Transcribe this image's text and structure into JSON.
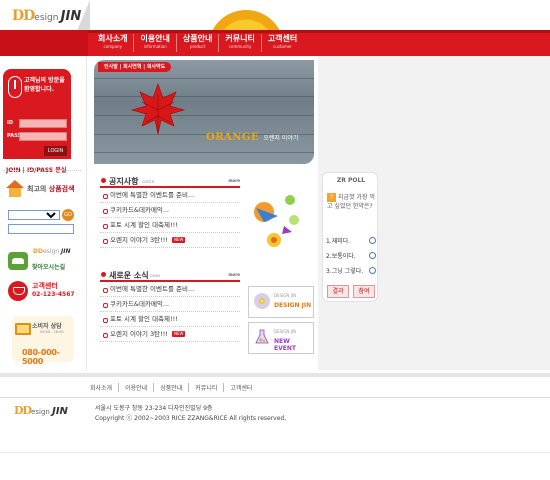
{
  "brand": {
    "dd": "DD",
    "design": "esign",
    "jin": "JIN"
  },
  "nav": [
    {
      "ko": "회사소개",
      "en": "company"
    },
    {
      "ko": "이용안내",
      "en": "information"
    },
    {
      "ko": "상품안내",
      "en": "product"
    },
    {
      "ko": "커뮤니티",
      "en": "community"
    },
    {
      "ko": "고객센터",
      "en": "customer"
    }
  ],
  "login": {
    "greeting": "고객님의 방문을 환영합니다.",
    "id_label": "ID",
    "pass_label": "PASS",
    "button": "LOGIN",
    "join": "JOIN",
    "find": "ID/PASS 분실"
  },
  "best_search": {
    "prefix": "최고의 ",
    "highlight": "상품검색",
    "go": "GO"
  },
  "map": {
    "label": "찾아오시는길"
  },
  "customer_center": {
    "title": "고객센터",
    "phone": "02-123-4567"
  },
  "consult": {
    "title": "소비자 상담",
    "hours": "09:00 - 18:00",
    "phone": "080-000-5000"
  },
  "banner": {
    "breadcrumb": "인사말 | 회사연혁 | 회사약도",
    "brand": "ORANGE",
    "subtitle": "오렌지 이야기"
  },
  "notice": {
    "title": "공지사항",
    "subtitle": "notice",
    "more": "more",
    "items": [
      "이번에 특별한 이벤트를 준비...",
      "쿠키카드&데카메익...",
      "포토 시계 할인 대축제!!!",
      "오렌지 이야기 3탄!!!"
    ],
    "new_badge": "NEW"
  },
  "news": {
    "title": "새로운 소식",
    "subtitle": "news",
    "more": "more",
    "items": [
      "이번에 특별한 이벤트를 준비...",
      "쿠키카드&데카메익...",
      "포토 시계 할인 대축제!!!",
      "오렌지 이야기 3탄!!!"
    ],
    "new_badge": "NEW"
  },
  "side_banners": [
    {
      "small": "DESIGN JIN",
      "big": "DESIGN JIN"
    },
    {
      "small": "DESIGN JIN",
      "big": "NEW EVENT"
    }
  ],
  "poll": {
    "title": "ZR POLL",
    "question": "지금껏 가장 먹고 싶었던 한약은?",
    "options": [
      "1.재미다.",
      "2.보통이다.",
      "3.그닝 그렇다."
    ],
    "vote": "결과",
    "result": "참여"
  },
  "footer": {
    "nav": [
      "회사소개",
      "이용안내",
      "상품안내",
      "커뮤니티",
      "고객센터"
    ],
    "address": "서울시 도봉구 창동 23-234 디자인진빌딩 9층",
    "copyright": "Copyright ⓒ 2002~2003 RICE ZZANG&RICE All rights reserved,"
  },
  "colors": {
    "brand_red": "#d9181f",
    "accent_orange": "#e07a16",
    "gray_panel": "#f2f2f2"
  }
}
